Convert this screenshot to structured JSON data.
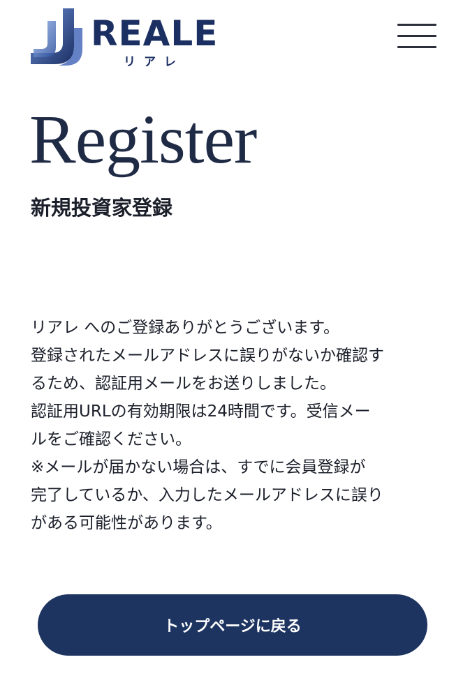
{
  "header": {
    "logo_text": "REALE",
    "logo_kana": "リアレ",
    "menu_icon": "hamburger-menu-icon"
  },
  "page": {
    "title": "Register",
    "subtitle": "新規投資家登録"
  },
  "message": {
    "lines": [
      "リアレ へのご登録ありがとうございます。",
      "登録されたメールアドレスに誤りがないか確認す",
      "るため、認証用メールをお送りしました。",
      "認証用URLの有効期限は24時間です。受信メー",
      "ルをご確認ください。",
      "※メールが届かない場合は、すでに会員登録が",
      "完了しているか、入力したメールアドレスに誤り",
      "がある可能性があります。"
    ]
  },
  "actions": {
    "back_to_top_label": "トップページに戻る"
  },
  "colors": {
    "brand_navy": "#1d3461",
    "logo_blue": "#1b2f62",
    "text": "#1b1f2a"
  }
}
